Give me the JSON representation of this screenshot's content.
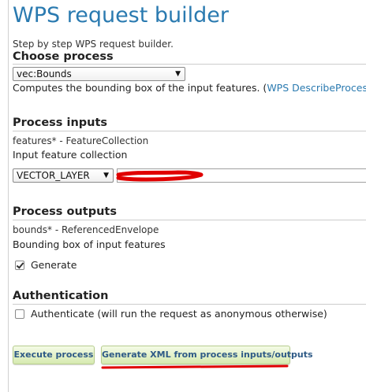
{
  "page": {
    "title": "WPS request builder",
    "intro": "Step by step WPS request builder."
  },
  "choose_process": {
    "heading": "Choose process",
    "selected_process": "vec:Bounds",
    "description_prefix": "Computes the bounding box of the input features. (",
    "describe_link": "WPS DescribeProcess",
    "description_suffix": ")"
  },
  "process_inputs": {
    "heading": "Process inputs",
    "input_name": "features* - FeatureCollection",
    "input_description": "Input feature collection",
    "source_type": "VECTOR_LAYER",
    "layer_value": ""
  },
  "process_outputs": {
    "heading": "Process outputs",
    "output_name": "bounds* - ReferencedEnvelope",
    "output_description": "Bounding box of input features",
    "generate_label": "Generate",
    "generate_checked": true
  },
  "authentication": {
    "heading": "Authentication",
    "authenticate_label": "Authenticate (will run the request as anonymous otherwise)",
    "authenticate_checked": false
  },
  "actions": {
    "execute_label": "Execute process",
    "generate_xml_label": "Generate XML from process inputs/outputs"
  },
  "colors": {
    "title": "#2a7ab0",
    "link": "#2a7ab0",
    "button_text": "#2e5a86",
    "annotation": "#e00000"
  }
}
